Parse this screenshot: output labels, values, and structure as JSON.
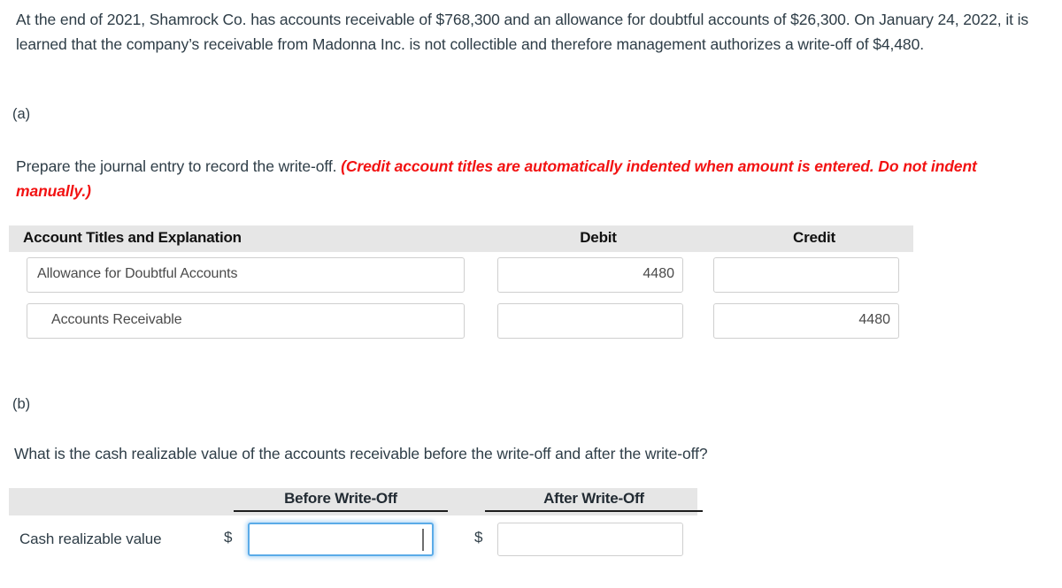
{
  "problem": {
    "text": "At the end of 2021, Shamrock Co. has accounts receivable of $768,300 and an allowance for doubtful accounts of $26,300. On January 24, 2022, it is learned that the company’s receivable from Madonna Inc. is not collectible and therefore management authorizes a write-off of $4,480."
  },
  "part_a": {
    "label": "(a)",
    "instruction_plain": "Prepare the journal entry to record the write-off.",
    "instruction_emphasis": "(Credit account titles are automatically indented when amount is entered. Do not indent manually.)",
    "table": {
      "columns": [
        "Account Titles and Explanation",
        "Debit",
        "Credit"
      ],
      "rows": [
        {
          "account": "Allowance for Doubtful Accounts",
          "debit": "4480",
          "credit": ""
        },
        {
          "account": "Accounts Receivable",
          "debit": "",
          "credit": "4480"
        }
      ]
    }
  },
  "part_b": {
    "label": "(b)",
    "question": "What is the cash realizable value of the accounts receivable before the write-off and after the write-off?",
    "table": {
      "columns": [
        "Before Write-Off",
        "After Write-Off"
      ],
      "row_label": "Cash realizable value",
      "currency_symbol": "$",
      "before_value": "",
      "after_value": "",
      "before_placeholder": "",
      "after_placeholder": ""
    }
  },
  "colors": {
    "emphasis_red": "#f21212",
    "header_gray": "#e6e6e6",
    "focus_blue": "#5aabe8",
    "text": "#2e3d47",
    "input_border": "#cfcfcf"
  }
}
